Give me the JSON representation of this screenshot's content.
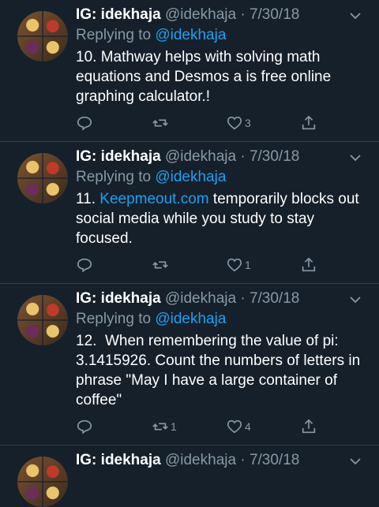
{
  "tweets": [
    {
      "name": "IG: idekhaja",
      "handle": "@idekhaja",
      "separator": "·",
      "date": "7/30/18",
      "replying_prefix": "Replying to",
      "replying_handle": "@idekhaja",
      "text": "10. Mathway helps with solving math equations and Desmos a is free online graphing calculator.!",
      "replies": "",
      "retweets": "",
      "likes": "3"
    },
    {
      "name": "IG: idekhaja",
      "handle": "@idekhaja",
      "separator": "·",
      "date": "7/30/18",
      "replying_prefix": "Replying to",
      "replying_handle": "@idekhaja",
      "text_prefix": "11. ",
      "link": "Keepmeout.com",
      "text_suffix": " temporarily blocks out social media while you study to stay focused.",
      "replies": "",
      "retweets": "",
      "likes": "1"
    },
    {
      "name": "IG: idekhaja",
      "handle": "@idekhaja",
      "separator": "·",
      "date": "7/30/18",
      "replying_prefix": "Replying to",
      "replying_handle": "@idekhaja",
      "text": "12.  When remembering the value of pi: 3.1415926. Count the numbers of letters in phrase \"May I have a large container of coffee\"",
      "replies": "",
      "retweets": "1",
      "likes": "4"
    },
    {
      "name": "IG: idekhaja",
      "handle": "@idekhaja",
      "separator": "·",
      "date": "7/30/18"
    }
  ],
  "colors": {
    "background": "#15202b",
    "text": "#ffffff",
    "muted": "#8899a6",
    "accent": "#1da1f2",
    "divider": "#2f3d4c"
  },
  "icons": [
    "reply-icon",
    "retweet-icon",
    "like-icon",
    "share-icon",
    "chevron-down-icon"
  ]
}
